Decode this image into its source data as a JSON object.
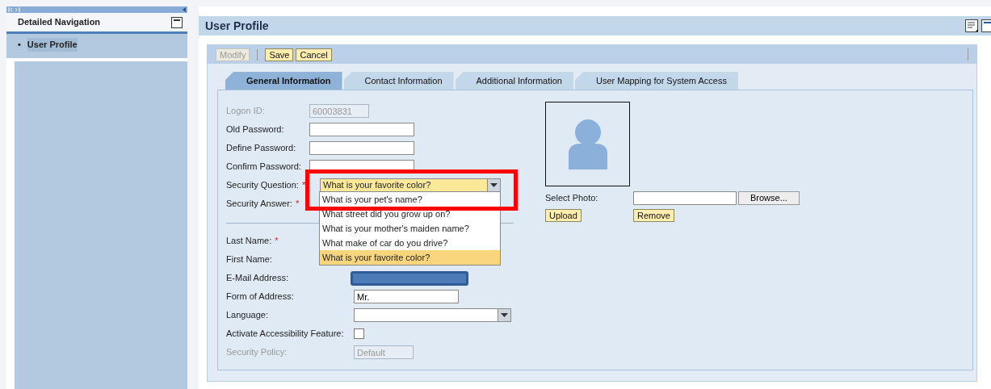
{
  "nav": {
    "title": "Detailed Navigation",
    "items": [
      {
        "label": "User Profile",
        "bullet": "•",
        "selected": true
      }
    ]
  },
  "page": {
    "title": "User Profile"
  },
  "toolbar": {
    "buttons": [
      {
        "label": "Modify",
        "disabled": true
      },
      {
        "label": "Save",
        "disabled": false
      },
      {
        "label": "Cancel",
        "disabled": false
      }
    ]
  },
  "tabs": [
    {
      "label": "General Information",
      "selected": true
    },
    {
      "label": "Contact Information",
      "selected": false
    },
    {
      "label": "Additional Information",
      "selected": false
    },
    {
      "label": "User Mapping for System Access",
      "selected": false
    }
  ],
  "account_fields": [
    {
      "label": "Logon ID:",
      "kind": "text",
      "value": "60003831",
      "disabled": true
    },
    {
      "label": "Old Password:",
      "kind": "text",
      "disabled": false
    },
    {
      "label": "Define Password:",
      "kind": "text",
      "disabled": false
    },
    {
      "label": "Confirm Password:",
      "kind": "text",
      "disabled": false
    },
    {
      "label": "Security Question:",
      "required_mark": "*",
      "kind": "select",
      "value": "What is your favorite color?"
    },
    {
      "label": "Security Answer:",
      "required_mark": "*",
      "kind": "covered"
    }
  ],
  "dropdown": {
    "options": [
      {
        "label": "What is your pet's name?",
        "selected": false
      },
      {
        "label": "What street did you grow up on?",
        "selected": false
      },
      {
        "label": "What is your mother's maiden name?",
        "selected": false
      },
      {
        "label": "What make of car do you drive?",
        "selected": false
      },
      {
        "label": "What is your favorite color?",
        "selected": true
      }
    ]
  },
  "personal_fields": [
    {
      "label": "Last Name:",
      "required_mark": "*",
      "kind": "covered"
    },
    {
      "label": "First Name:",
      "kind": "covered"
    },
    {
      "label": "E-Mail Address:",
      "kind": "redacted"
    },
    {
      "label": "Form of Address:",
      "kind": "text",
      "value": "Mr.",
      "disabled": false
    },
    {
      "label": "Language:",
      "kind": "select"
    },
    {
      "label": "Activate Accessibility Feature:",
      "kind": "checkbox",
      "checked": false
    },
    {
      "label": "Security Policy:",
      "kind": "text",
      "value": "Default",
      "disabled": true
    }
  ],
  "photo": {
    "select_label": "Select Photo:",
    "browse_button": "Browse...",
    "upload_button": "Upload",
    "remove_button": "Remove"
  }
}
